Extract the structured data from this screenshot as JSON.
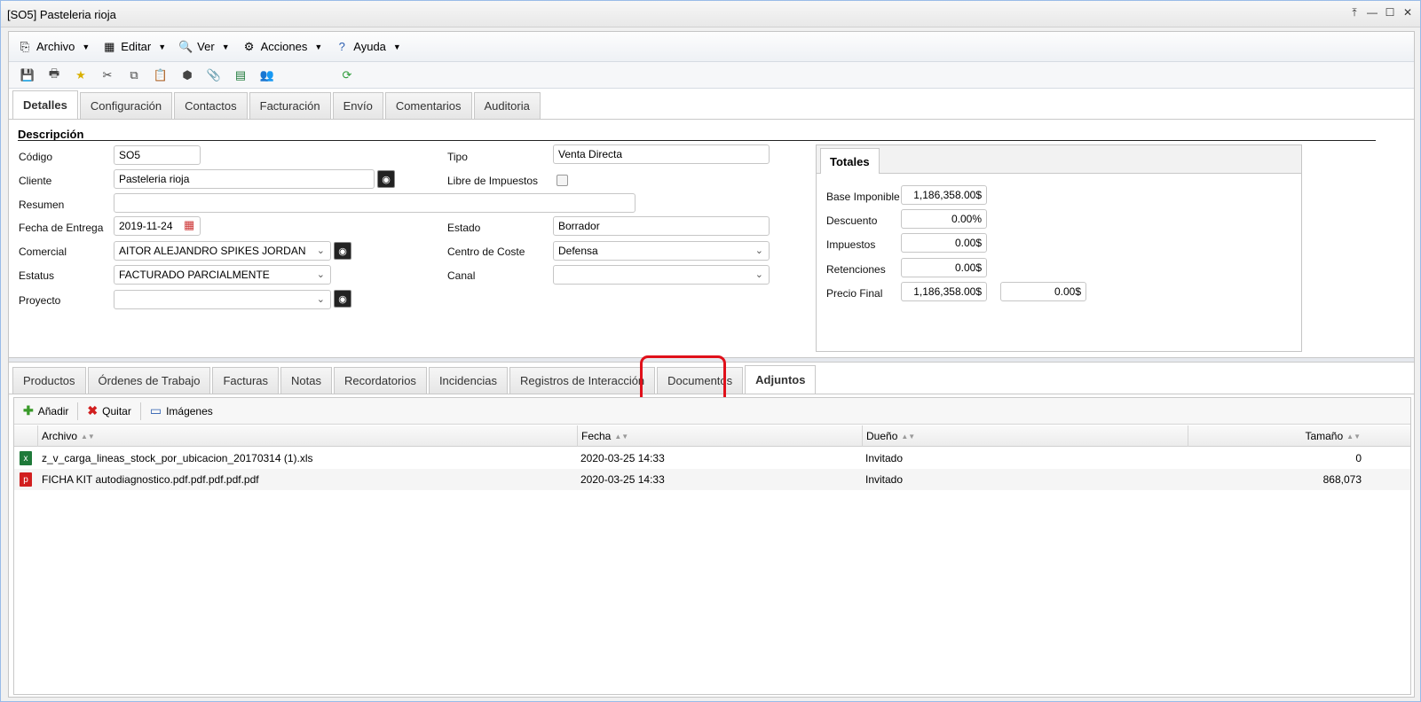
{
  "window": {
    "title": "[SO5] Pasteleria rioja"
  },
  "window_buttons": [
    "⤒",
    "—",
    "☐",
    "✕"
  ],
  "menu": [
    {
      "label": "Archivo",
      "icon": "archive-icon"
    },
    {
      "label": "Editar",
      "icon": "edit-icon"
    },
    {
      "label": "Ver",
      "icon": "view-icon"
    },
    {
      "label": "Acciones",
      "icon": "actions-icon"
    },
    {
      "label": "Ayuda",
      "icon": "help-icon"
    }
  ],
  "top_tabs": [
    "Detalles",
    "Configuración",
    "Contactos",
    "Facturación",
    "Envío",
    "Comentarios",
    "Auditoria"
  ],
  "section": {
    "title": "Descripción"
  },
  "form": {
    "codigo_label": "Código",
    "codigo": "SO5",
    "cliente_label": "Cliente",
    "cliente": "Pasteleria rioja",
    "resumen_label": "Resumen",
    "resumen": "",
    "fecha_label": "Fecha de Entrega",
    "fecha": "2019-11-24",
    "comercial_label": "Comercial",
    "comercial": "AITOR ALEJANDRO SPIKES JORDAN",
    "estatus_label": "Estatus",
    "estatus": "FACTURADO PARCIALMENTE",
    "proyecto_label": "Proyecto",
    "proyecto": "",
    "tipo_label": "Tipo",
    "tipo": "Venta Directa",
    "libre_label": "Libre de Impuestos",
    "estado_label": "Estado",
    "estado": "Borrador",
    "centro_label": "Centro de Coste",
    "centro": "Defensa",
    "canal_label": "Canal",
    "canal": ""
  },
  "totals": {
    "tab": "Totales",
    "base_label": "Base Imponible",
    "base": "1,186,358.00$",
    "descuento_label": "Descuento",
    "descuento": "0.00%",
    "impuestos_label": "Impuestos",
    "impuestos": "0.00$",
    "retenciones_label": "Retenciones",
    "retenciones": "0.00$",
    "precio_label": "Precio Final",
    "precio": "1,186,358.00$",
    "precio2": "0.00$"
  },
  "bottom_tabs": [
    "Productos",
    "Órdenes de Trabajo",
    "Facturas",
    "Notas",
    "Recordatorios",
    "Incidencias",
    "Registros de Interacción",
    "Documentos",
    "Adjuntos"
  ],
  "grid_toolbar": {
    "add": "Añadir",
    "remove": "Quitar",
    "images": "Imágenes"
  },
  "grid": {
    "columns": [
      "Archivo",
      "Fecha",
      "Dueño",
      "Tamaño"
    ],
    "rows": [
      {
        "file": "z_v_carga_lineas_stock_por_ubicacion_20170314 (1).xls",
        "type": "xls",
        "date": "2020-03-25 14:33",
        "owner": "Invitado",
        "size": "0"
      },
      {
        "file": "FICHA KIT autodiagnostico.pdf.pdf.pdf.pdf.pdf",
        "type": "pdf",
        "date": "2020-03-25 14:33",
        "owner": "Invitado",
        "size": "868,073"
      }
    ]
  },
  "colors": {
    "highlight": "#e0101a",
    "xls": "#1f7a3a",
    "pdf": "#d11f1f"
  }
}
